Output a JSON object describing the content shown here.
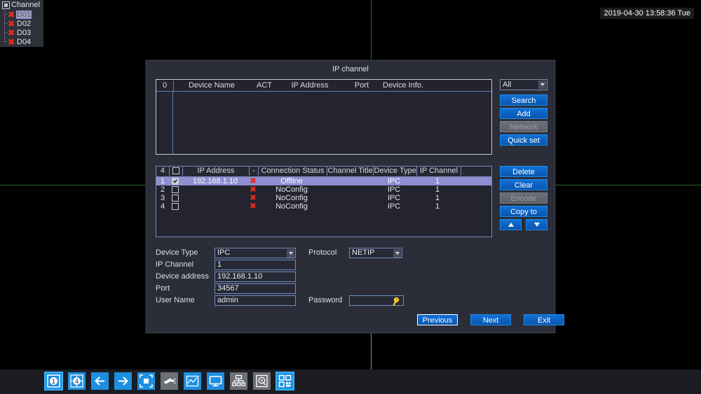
{
  "timestamp": "2019-04-30 13:58:36 Tue",
  "channel_panel": {
    "header": "Channel",
    "header_icon": "window-icon",
    "items": [
      {
        "label": "D01",
        "status_icon": "red-x-icon",
        "selected": true
      },
      {
        "label": "D02",
        "status_icon": "red-x-icon",
        "selected": false
      },
      {
        "label": "D03",
        "status_icon": "red-x-icon",
        "selected": false
      },
      {
        "label": "D04",
        "status_icon": "red-x-icon",
        "selected": false
      }
    ]
  },
  "dialog": {
    "title": "IP channel",
    "search_table": {
      "columns": [
        "0",
        "Device Name",
        "ACT",
        "IP Address",
        "Port",
        "Device Info."
      ],
      "rows": []
    },
    "search_controls": {
      "filter_value": "All",
      "filter_options": [
        "All"
      ],
      "search_label": "Search",
      "add_label": "Add",
      "network_label": "Network",
      "network_disabled": true,
      "quickset_label": "Quick set"
    },
    "config_table": {
      "columns": [
        "4",
        "",
        "IP Address",
        "-",
        "Connection Status",
        "Channel Title",
        "Device Type",
        "IP Channel",
        ""
      ],
      "rows": [
        {
          "index": "1",
          "checked": true,
          "ip_address": "192.168.1.10",
          "dash_icon": "red-x-icon",
          "connection_status": "Offline",
          "channel_title": "",
          "device_type": "IPC",
          "ip_channel": "1",
          "selected": true
        },
        {
          "index": "2",
          "checked": false,
          "ip_address": "",
          "dash_icon": "red-x-icon",
          "connection_status": "NoConfig",
          "channel_title": "",
          "device_type": "IPC",
          "ip_channel": "1",
          "selected": false
        },
        {
          "index": "3",
          "checked": false,
          "ip_address": "",
          "dash_icon": "red-x-icon",
          "connection_status": "NoConfig",
          "channel_title": "",
          "device_type": "IPC",
          "ip_channel": "1",
          "selected": false
        },
        {
          "index": "4",
          "checked": false,
          "ip_address": "",
          "dash_icon": "red-x-icon",
          "connection_status": "NoConfig",
          "channel_title": "",
          "device_type": "IPC",
          "ip_channel": "1",
          "selected": false
        }
      ]
    },
    "config_controls": {
      "delete_label": "Delete",
      "clear_label": "Clear",
      "encode_label": "Encode",
      "encode_disabled": true,
      "copyto_label": "Copy to",
      "up_icon": "triangle-up-icon",
      "down_icon": "triangle-down-icon"
    },
    "form": {
      "device_type_label": "Device Type",
      "device_type_value": "IPC",
      "device_type_options": [
        "IPC"
      ],
      "protocol_label": "Protocol",
      "protocol_value": "NETIP",
      "protocol_options": [
        "NETIP"
      ],
      "ip_channel_label": "IP Channel",
      "ip_channel_value": "1",
      "device_address_label": "Device address",
      "device_address_value": "192.168.1.10",
      "port_label": "Port",
      "port_value": "34567",
      "user_name_label": "User Name",
      "user_name_value": "admin",
      "password_label": "Password",
      "password_value": "",
      "password_icon": "key-icon"
    },
    "actions": {
      "previous_label": "Previous",
      "next_label": "Next",
      "exit_label": "Exit"
    }
  },
  "taskbar": {
    "buttons": [
      {
        "name": "view-1-split",
        "icon": "one-window-icon",
        "style": "blue",
        "selected": true,
        "label": "1"
      },
      {
        "name": "view-4-split",
        "icon": "four-window-icon",
        "style": "blue",
        "selected": false,
        "label": "4"
      },
      {
        "name": "previous-page",
        "icon": "arrow-left-icon",
        "style": "blue",
        "selected": false,
        "label": ""
      },
      {
        "name": "next-page",
        "icon": "arrow-right-icon",
        "style": "blue",
        "selected": false,
        "label": ""
      },
      {
        "name": "manual-record",
        "icon": "record-square-icon",
        "style": "blue",
        "selected": false,
        "label": ""
      },
      {
        "name": "ptz-control",
        "icon": "camera-icon",
        "style": "gray",
        "selected": false,
        "label": ""
      },
      {
        "name": "color-setting",
        "icon": "graph-icon",
        "style": "blue",
        "selected": false,
        "label": ""
      },
      {
        "name": "display-output",
        "icon": "monitor-icon",
        "style": "blue",
        "selected": false,
        "label": ""
      },
      {
        "name": "network-status",
        "icon": "network-tree-icon",
        "style": "gray",
        "selected": false,
        "label": ""
      },
      {
        "name": "hdd-status",
        "icon": "hard-disk-icon",
        "style": "gray",
        "selected": false,
        "label": ""
      },
      {
        "name": "main-menu",
        "icon": "grid-menu-icon",
        "style": "blue",
        "selected": true,
        "label": ""
      }
    ]
  },
  "colors": {
    "accent_blue": "#0c62c2",
    "selection_purple": "#8e8ed0",
    "error_red": "#e02c20",
    "grid_green": "#2f6b38",
    "panel_bg": "#2b2d38"
  }
}
